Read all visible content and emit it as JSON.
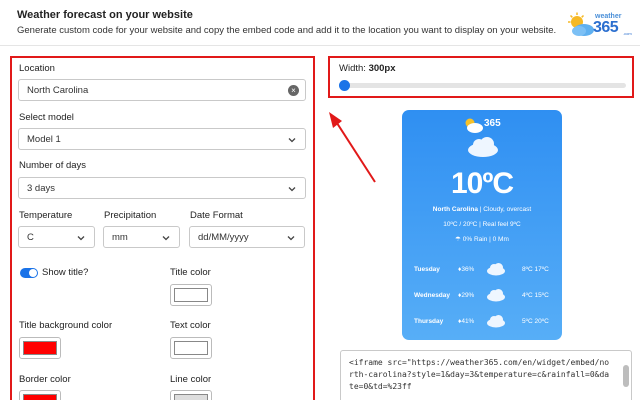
{
  "header": {
    "title": "Weather forecast on your website",
    "description": "Generate custom code for your website and copy the embed code and add it to the location you want to display on your website.",
    "logo": {
      "word": "weather",
      "number": "365",
      "suffix": ".com"
    }
  },
  "form": {
    "location_label": "Location",
    "location_value": "North Carolina",
    "model_label": "Select model",
    "model_value": "Model 1",
    "days_label": "Number of days",
    "days_value": "3 days",
    "temperature_label": "Temperature",
    "temperature_value": "C",
    "precipitation_label": "Precipitation",
    "precipitation_value": "mm",
    "date_format_label": "Date Format",
    "date_format_value": "dd/MM/yyyy",
    "show_title_label": "Show title?",
    "title_color_label": "Title color",
    "title_bg_label": "Title background color",
    "text_color_label": "Text color",
    "border_color_label": "Border color",
    "line_color_label": "Line color"
  },
  "colors": {
    "title_color": "#ffffff",
    "title_bg": "#ff0000",
    "text_color": "#ffffff",
    "border_color": "#ff0000",
    "line_color": "#dddddd",
    "accent": "#1a73e8",
    "highlight": "#e11919"
  },
  "width_control": {
    "label": "Width:",
    "value": "300px"
  },
  "widget": {
    "logo_number": "365",
    "temperature": "10ºC",
    "location": "North Carolina",
    "condition": " | Cloudy, overcast",
    "feel": "10ºC / 20ºC | Real feel 9ºC",
    "rain": "0% Rain | 0 Mm",
    "days": [
      {
        "day": "Tuesday",
        "pct": "36%",
        "range": "8ºC 17ºC"
      },
      {
        "day": "Wednesday",
        "pct": "29%",
        "range": "4ºC 15ºC"
      },
      {
        "day": "Thursday",
        "pct": "41%",
        "range": "5ºC 20ºC"
      }
    ]
  },
  "code": "<iframe src=\"https://weather365.com/en/widget/embed/north-carolina?style=1&day=3&temperature=c&rainfall=0&date=0&td=%23ff"
}
